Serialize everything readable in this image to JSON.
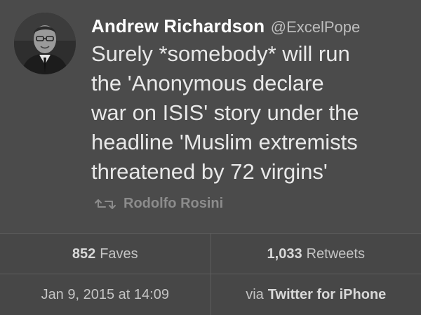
{
  "tweet": {
    "author_name": "Andrew Richardson",
    "author_handle": "@ExcelPope",
    "avatar_icon": "profile-photo",
    "text_lines": [
      "Surely *somebody* will run",
      "the 'Anonymous declare",
      "war on ISIS' story under the",
      "headline 'Muslim extremists",
      "threatened by 72 virgins'"
    ],
    "retweet_icon": "retweet-icon",
    "retweeted_by": "Rodolfo Rosini"
  },
  "stats": {
    "faves_count": "852",
    "faves_label": "Faves",
    "retweets_count": "1,033",
    "retweets_label": "Retweets"
  },
  "meta": {
    "timestamp": "Jan 9, 2015 at 14:09",
    "via_label": "via",
    "client": "Twitter for iPhone"
  },
  "colors": {
    "background": "#4a4a4a",
    "name": "#ffffff",
    "text": "#e8e8e8",
    "muted": "#8c8c8c"
  }
}
